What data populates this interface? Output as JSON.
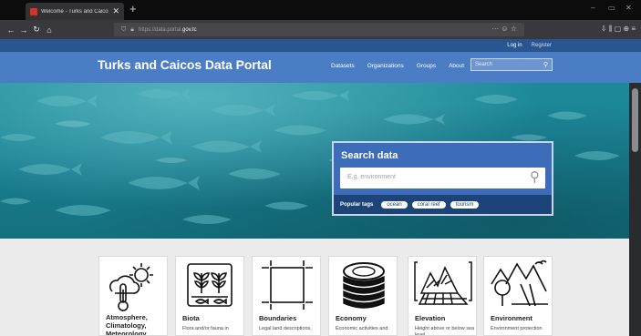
{
  "browser": {
    "tab_title": "Welcome - Turks and Caicos D",
    "tab_close": "✕",
    "new_tab": "+",
    "url_prefix": "https://data.portal.",
    "url_domain": "gov.tc",
    "url_actions": "··· ☺ ☆",
    "toolbar_icons": "⇩ ⫼ ▢ ⊕ ≡",
    "window_controls": [
      "–",
      "▭",
      "✕"
    ]
  },
  "account": {
    "login": "Log in",
    "register": "Register"
  },
  "site": {
    "title": "Turks and Caicos Data Portal",
    "nav": [
      "Datasets",
      "Organizations",
      "Groups",
      "About"
    ],
    "search_placeholder": "Search"
  },
  "hero": {
    "search_title": "Search data",
    "search_placeholder": "E.g. environment",
    "popular_label": "Popular tags",
    "tags": [
      "ocean",
      "coral reef",
      "tourism"
    ]
  },
  "groups": [
    {
      "title": "Atmosphere, Climatology, Meteorology",
      "desc": "",
      "icon": "weather-thermometer-icon"
    },
    {
      "title": "Biota",
      "desc": "Flora and/or fauna in",
      "icon": "plants-fish-icon"
    },
    {
      "title": "Boundaries",
      "desc": "Legal land descriptions,",
      "icon": "boundary-square-icon"
    },
    {
      "title": "Economy",
      "desc": "Economic activities and",
      "icon": "coin-stack-icon"
    },
    {
      "title": "Elevation",
      "desc": "Height above or below sea level",
      "icon": "elevation-mountain-icon"
    },
    {
      "title": "Environment",
      "desc": "Environment protection",
      "icon": "environment-tree-icon"
    }
  ],
  "colors": {
    "brand": "#4a7dc4",
    "brand_dark": "#295590",
    "hero_water": "#1a8193",
    "tag_strip": "#1c4478"
  }
}
